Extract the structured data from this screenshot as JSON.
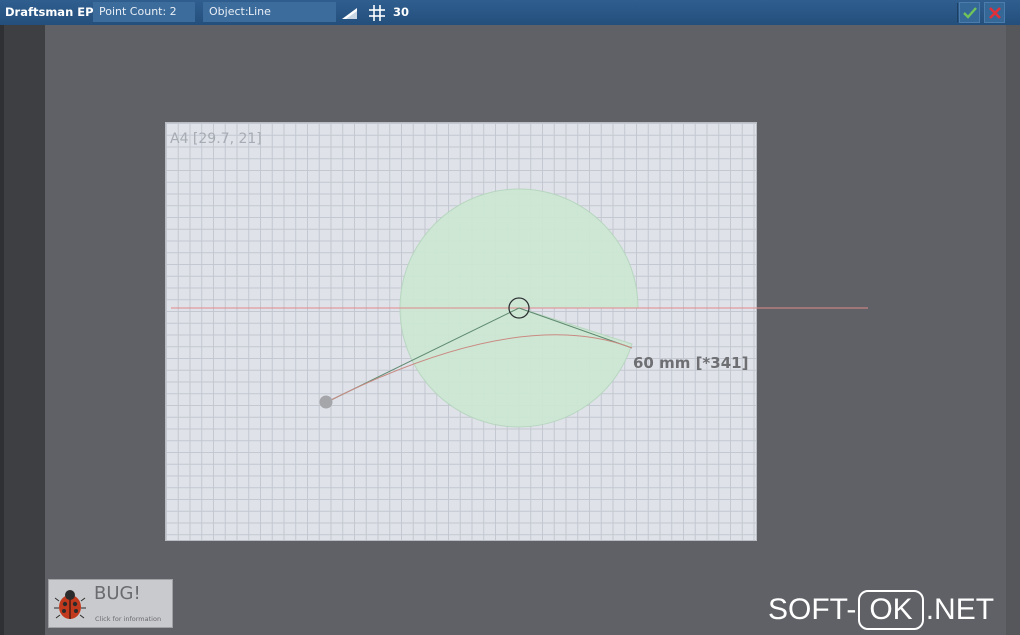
{
  "toolbar": {
    "app_title": "Draftsman EP",
    "point_count_label": "Point Count: 2",
    "object_label": "Object:",
    "object_value": "Line",
    "snap_icon": "triangle-ruler-icon",
    "grid_icon": "grid-hash-icon",
    "grid_value": "30",
    "confirm_icon": "check-icon",
    "cancel_icon": "close-x-icon"
  },
  "canvas": {
    "paper_label": "A4 [29.7, 21]",
    "measurement": "60 mm [*341]"
  },
  "bug_panel": {
    "icon": "ladybug-icon",
    "title": "BUG!",
    "subtitle": "Click for information"
  },
  "watermark": {
    "left": "SOFT-",
    "boxed": "OK",
    "right": ".NET"
  },
  "colors": {
    "toolbar": "#2a5684",
    "workspace": "#5f6166",
    "paper": "#dfe2e9",
    "guide_line": "#e08a8a",
    "sector_fill": "#cde8d4",
    "confirm": "#6fc35a",
    "cancel": "#e0303a"
  }
}
